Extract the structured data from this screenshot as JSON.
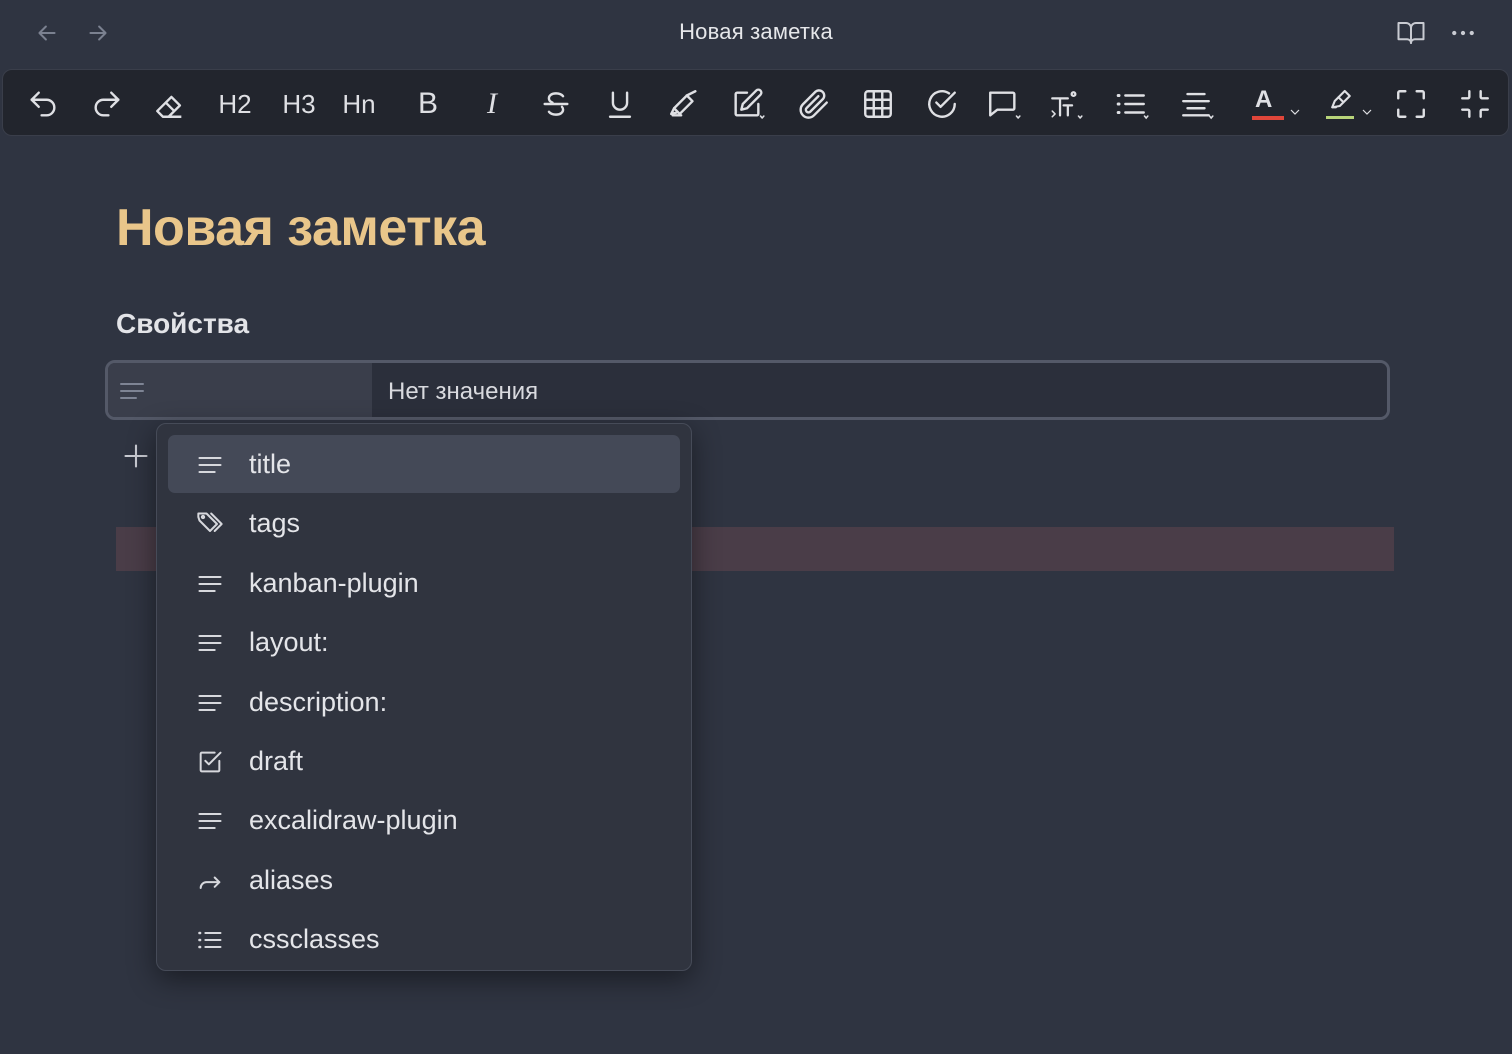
{
  "window": {
    "title": "Новая заметка"
  },
  "toolbar": {
    "h2_label": "H2",
    "h3_label": "H3",
    "hn_label": "Hn",
    "bold_label": "B",
    "italic_label": "I",
    "underline_label": "U",
    "text_color_label": "A",
    "text_color": "#e0463a",
    "highlight_color": "#b8d47a"
  },
  "note": {
    "title": "Новая заметка",
    "properties_heading": "Свойства"
  },
  "property_row": {
    "key_placeholder": "",
    "value_placeholder": "Нет значения"
  },
  "dropdown": {
    "items": [
      {
        "label": "title",
        "icon": "text-lines-icon",
        "active": true
      },
      {
        "label": "tags",
        "icon": "tags-icon"
      },
      {
        "label": "kanban-plugin",
        "icon": "text-lines-icon"
      },
      {
        "label": "layout:",
        "icon": "text-lines-icon"
      },
      {
        "label": "description:",
        "icon": "text-lines-icon"
      },
      {
        "label": "draft",
        "icon": "checkbox-icon"
      },
      {
        "label": "excalidraw-plugin",
        "icon": "text-lines-icon"
      },
      {
        "label": "aliases",
        "icon": "forward-arrow-icon"
      },
      {
        "label": "cssclasses",
        "icon": "list-icon"
      }
    ]
  }
}
